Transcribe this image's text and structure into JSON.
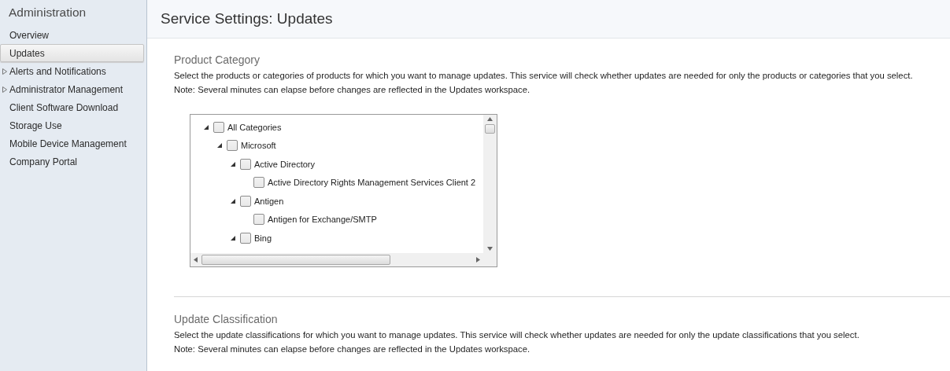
{
  "sidebar": {
    "title": "Administration",
    "items": [
      {
        "label": "Overview",
        "kind": "link",
        "selected": false
      },
      {
        "label": "Updates",
        "kind": "link",
        "selected": true
      },
      {
        "label": "Alerts and Notifications",
        "kind": "group",
        "expanded": false,
        "selected": false
      },
      {
        "label": "Administrator Management",
        "kind": "group",
        "expanded": false,
        "selected": false
      },
      {
        "label": "Client Software Download",
        "kind": "link",
        "selected": false
      },
      {
        "label": "Storage Use",
        "kind": "link",
        "selected": false
      },
      {
        "label": "Mobile Device Management",
        "kind": "link",
        "selected": false
      },
      {
        "label": "Company Portal",
        "kind": "link",
        "selected": false
      }
    ]
  },
  "page": {
    "title": "Service Settings: Updates"
  },
  "sections": [
    {
      "title": "Product Category",
      "description": "Select the products or categories of products for which you want to manage updates. This service will check whether updates are needed for only the products or categories that you select.",
      "note": "Note: Several minutes can elapse before changes are reflected in the Updates workspace.",
      "tree": [
        {
          "label": "All Categories",
          "checked": false,
          "expanded": true,
          "children": [
            {
              "label": "Microsoft",
              "checked": false,
              "expanded": true,
              "children": [
                {
                  "label": "Active Directory",
                  "checked": false,
                  "expanded": true,
                  "children": [
                    {
                      "label": "Active Directory Rights Management Services Client 2",
                      "checked": false
                    }
                  ]
                },
                {
                  "label": "Antigen",
                  "checked": false,
                  "expanded": true,
                  "children": [
                    {
                      "label": "Antigen for Exchange/SMTP",
                      "checked": false
                    }
                  ]
                },
                {
                  "label": "Bing",
                  "checked": false,
                  "expanded": true
                }
              ]
            }
          ]
        }
      ]
    },
    {
      "title": "Update Classification",
      "description": "Select the update classifications for which you want to manage updates. This service will check whether updates are needed for only the update classifications that you select.",
      "note": "Note: Several minutes can elapse before changes are reflected in the Updates workspace."
    }
  ]
}
